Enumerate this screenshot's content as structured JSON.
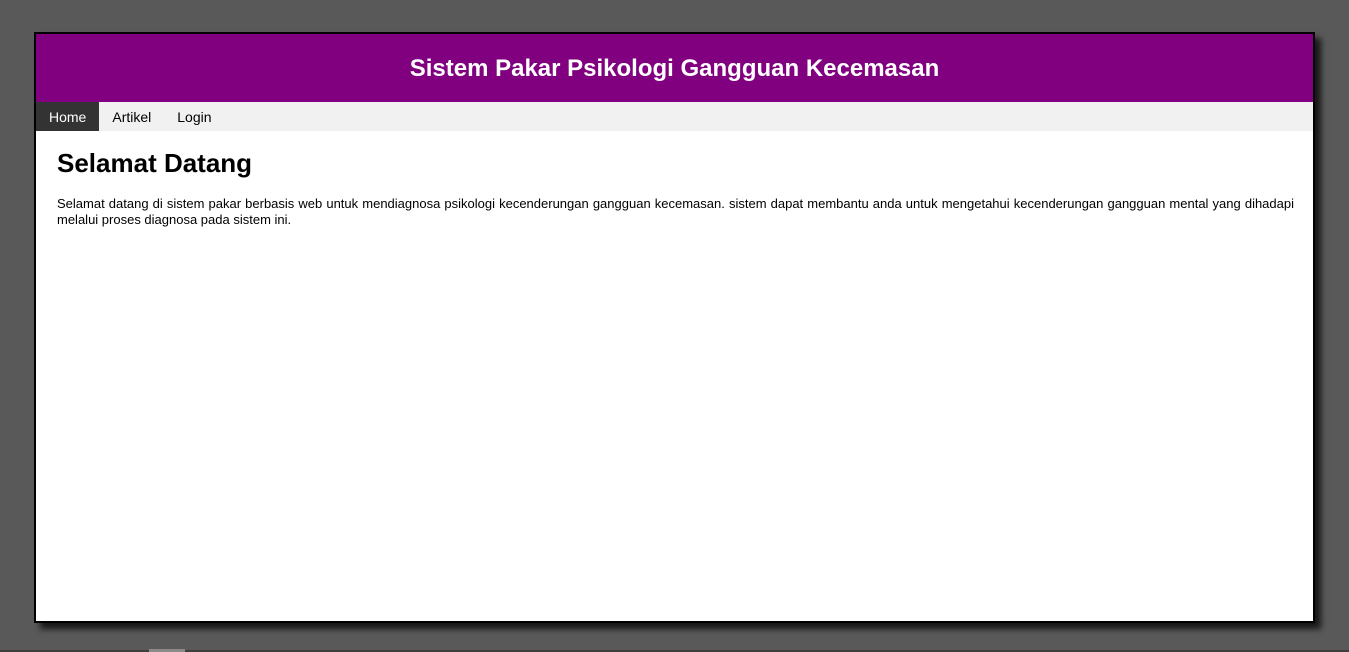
{
  "header": {
    "title": "Sistem Pakar Psikologi Gangguan Kecemasan"
  },
  "nav": {
    "items": [
      {
        "label": "Home",
        "active": true
      },
      {
        "label": "Artikel",
        "active": false
      },
      {
        "label": "Login",
        "active": false
      }
    ]
  },
  "main": {
    "heading": "Selamat Datang",
    "paragraph": "Selamat datang di sistem pakar berbasis web untuk mendiagnosa psikologi kecenderungan gangguan kecemasan. sistem dapat membantu anda untuk mengetahui kecenderungan gangguan mental yang dihadapi melalui proses diagnosa pada sistem ini."
  },
  "colors": {
    "header_bg": "#800080",
    "nav_bg": "#f1f1f1",
    "nav_active_bg": "#333333",
    "page_bg": "#595959"
  }
}
